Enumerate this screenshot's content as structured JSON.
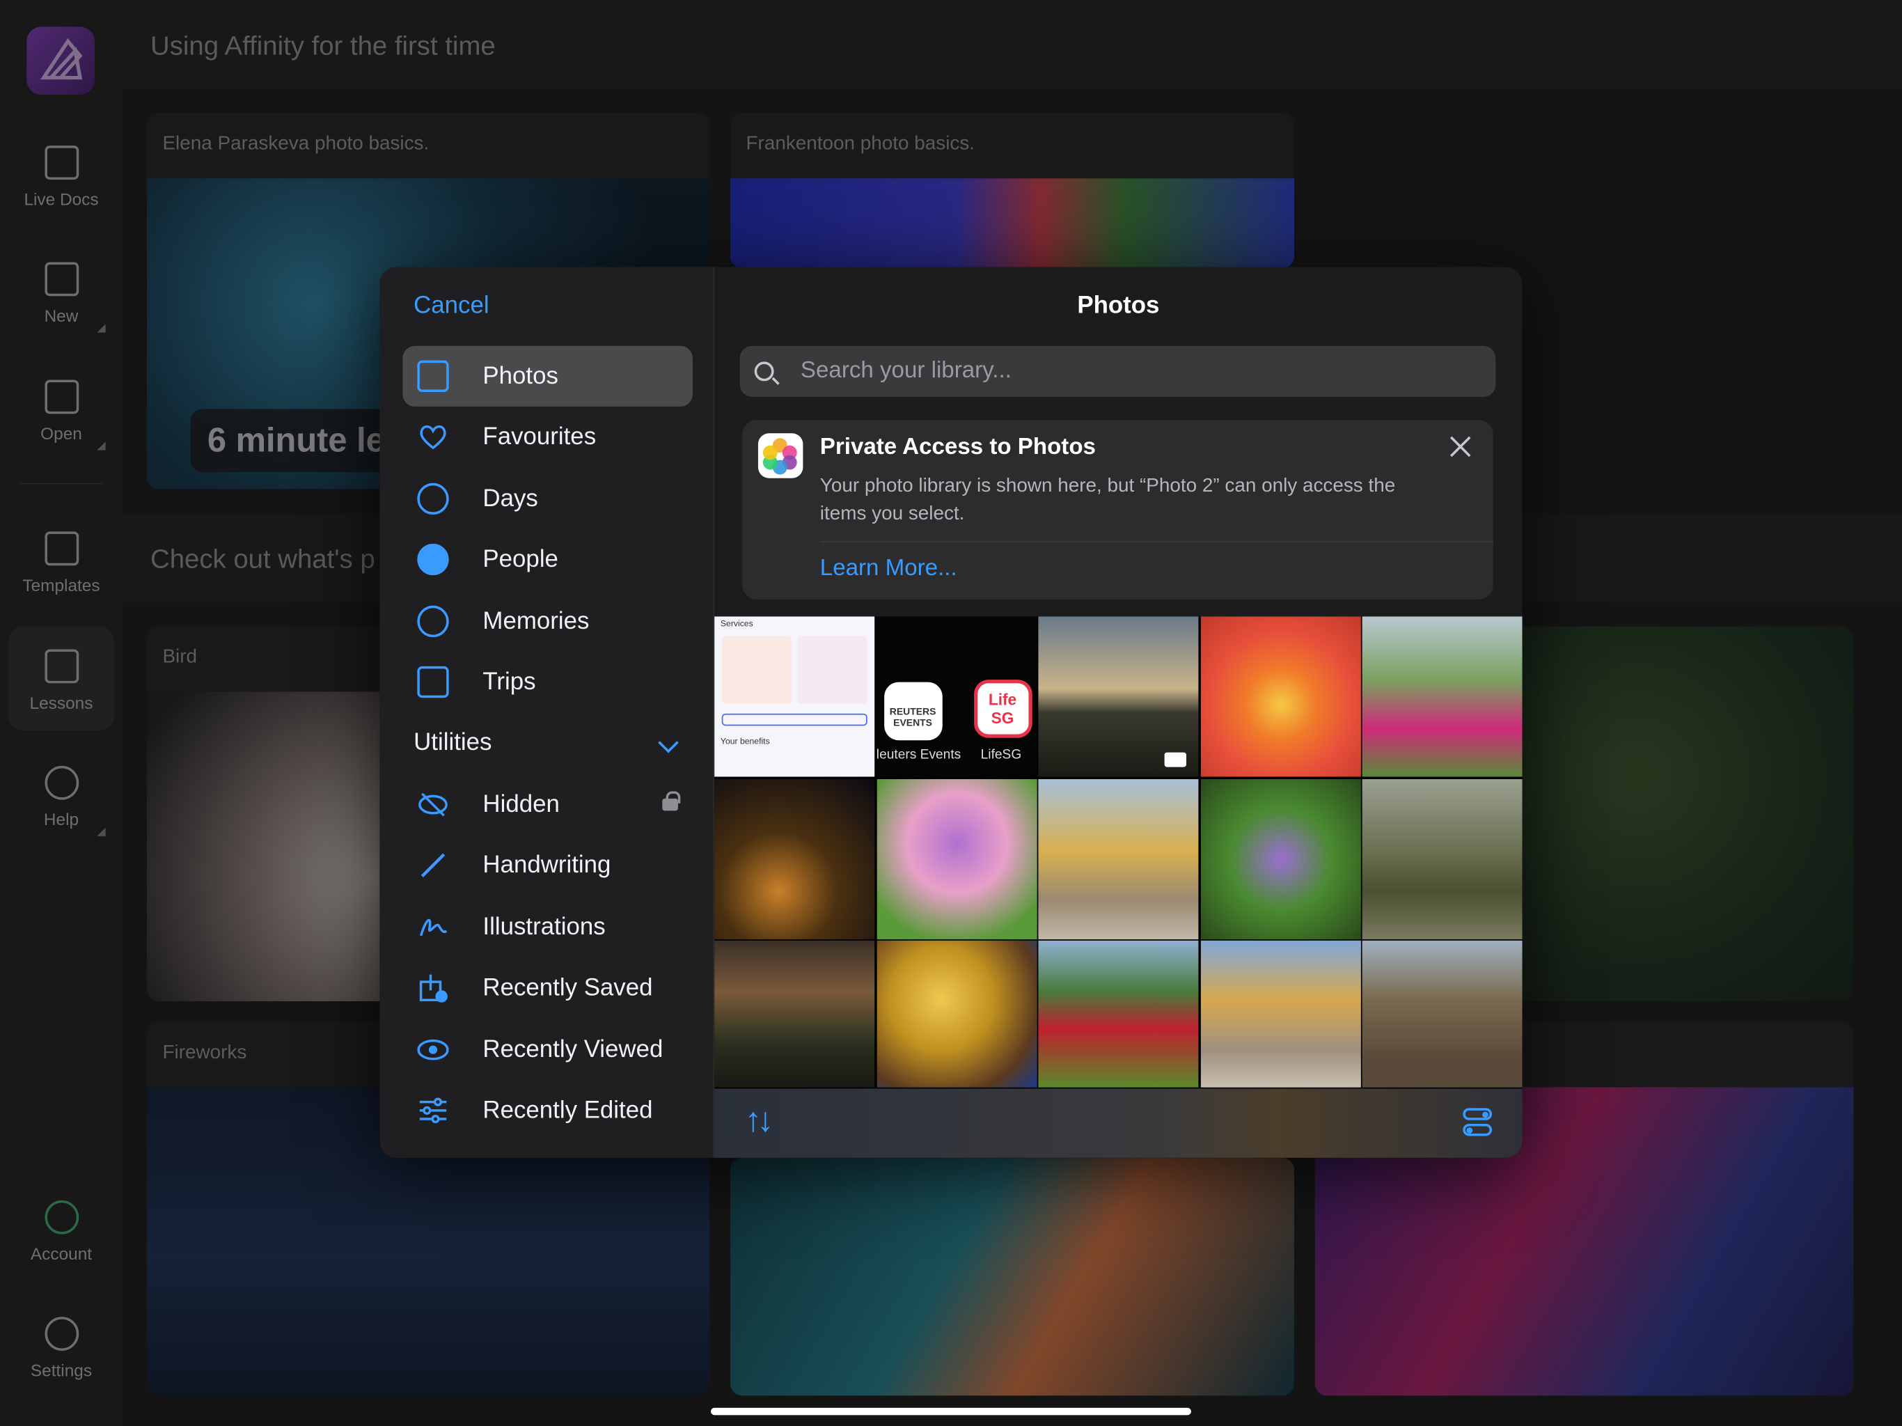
{
  "header": {
    "title": "Using Affinity for the first time",
    "section2": "Check out what's p"
  },
  "rail": {
    "items": [
      {
        "label": "Live Docs",
        "icon": "live-docs-icon"
      },
      {
        "label": "New",
        "icon": "new-document-icon"
      },
      {
        "label": "Open",
        "icon": "folder-icon"
      },
      {
        "label": "Templates",
        "icon": "templates-icon"
      },
      {
        "label": "Lessons",
        "icon": "book-icon"
      },
      {
        "label": "Help",
        "icon": "help-icon"
      },
      {
        "label": "Account",
        "icon": "account-icon"
      },
      {
        "label": "Settings",
        "icon": "gear-icon"
      }
    ]
  },
  "cards": {
    "elena": "Elena Paraskeva photo basics.",
    "franken": "Frankentoon photo basics.",
    "bird": "Bird",
    "fireworks": "Fireworks",
    "overlay": "6 minute le"
  },
  "picker": {
    "cancel": "Cancel",
    "title": "Photos",
    "search_placeholder": "Search your library...",
    "nav": [
      {
        "label": "Photos",
        "icon": "photos-stack-icon"
      },
      {
        "label": "Favourites",
        "icon": "heart-icon"
      },
      {
        "label": "Days",
        "icon": "clock-icon"
      },
      {
        "label": "People",
        "icon": "person-circle-icon"
      },
      {
        "label": "Memories",
        "icon": "memories-play-icon"
      },
      {
        "label": "Trips",
        "icon": "suitcase-icon"
      }
    ],
    "utilities_label": "Utilities",
    "utilities": [
      {
        "label": "Hidden",
        "icon": "eye-slash-icon"
      },
      {
        "label": "Handwriting",
        "icon": "pencil-icon"
      },
      {
        "label": "Illustrations",
        "icon": "scribble-icon"
      },
      {
        "label": "Recently Saved",
        "icon": "download-badge-icon"
      },
      {
        "label": "Recently Viewed",
        "icon": "eye-icon"
      },
      {
        "label": "Recently Edited",
        "icon": "sliders-icon"
      }
    ],
    "notice": {
      "title": "Private Access to Photos",
      "body": "Your photo library is shown here, but “Photo 2” can only access the items you select.",
      "link": "Learn More..."
    },
    "thumbs_text": {
      "services": "Services",
      "reuters": "REUTERS",
      "events": "EVENTS",
      "life": "Life",
      "sg": "SG",
      "reuters_events": "leuters Events",
      "lifesg": "LifeSG",
      "your_benefits": "Your benefits"
    }
  },
  "colors": {
    "accent": "#3a9bff",
    "sheet_bg": "#1c1c1e",
    "sidebar_bg": "#1f1f21"
  }
}
